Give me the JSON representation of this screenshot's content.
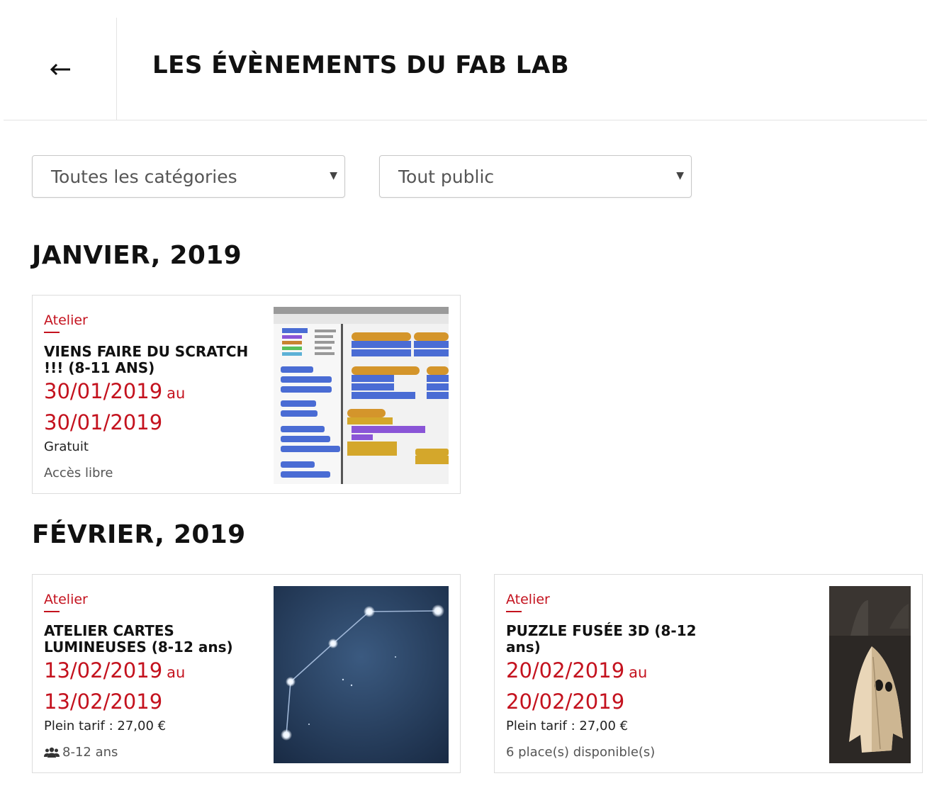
{
  "header": {
    "back_icon": "arrow-left-icon",
    "title": "LES ÉVÈNEMENTS DU FAB LAB"
  },
  "filters": {
    "category": {
      "selected": "Toutes les catégories"
    },
    "audience": {
      "selected": "Tout public"
    }
  },
  "months": [
    {
      "label": "JANVIER, 2019",
      "events": [
        {
          "category": "Atelier",
          "title": "VIENS FAIRE DU SCRATCH !!! (8-11 ANS)",
          "start": "30/01/2019",
          "connector": "au",
          "end": "30/01/2019",
          "price": "Gratuit",
          "extra": "Accès libre",
          "image": "scratch-screenshot"
        }
      ]
    },
    {
      "label": "FÉVRIER, 2019",
      "events": [
        {
          "category": "Atelier",
          "title": "ATELIER CARTES LUMINEUSES (8-12 ans)",
          "start": "13/02/2019",
          "connector": "au",
          "end": "13/02/2019",
          "price": "Plein tarif : 27,00 €",
          "extra": "8-12 ans",
          "extra_icon": "users-icon",
          "image": "constellation-photo"
        },
        {
          "category": "Atelier",
          "title": "PUZZLE FUSÉE 3D (8-12 ans)",
          "start": "20/02/2019",
          "connector": "au",
          "end": "20/02/2019",
          "price": "Plein tarif : 27,00 €",
          "extra": "6 place(s) disponible(s)",
          "image": "wooden-rocket-photo"
        }
      ]
    }
  ],
  "colors": {
    "accent": "#c4121e",
    "text": "#111111",
    "border": "#dcdcdc"
  }
}
